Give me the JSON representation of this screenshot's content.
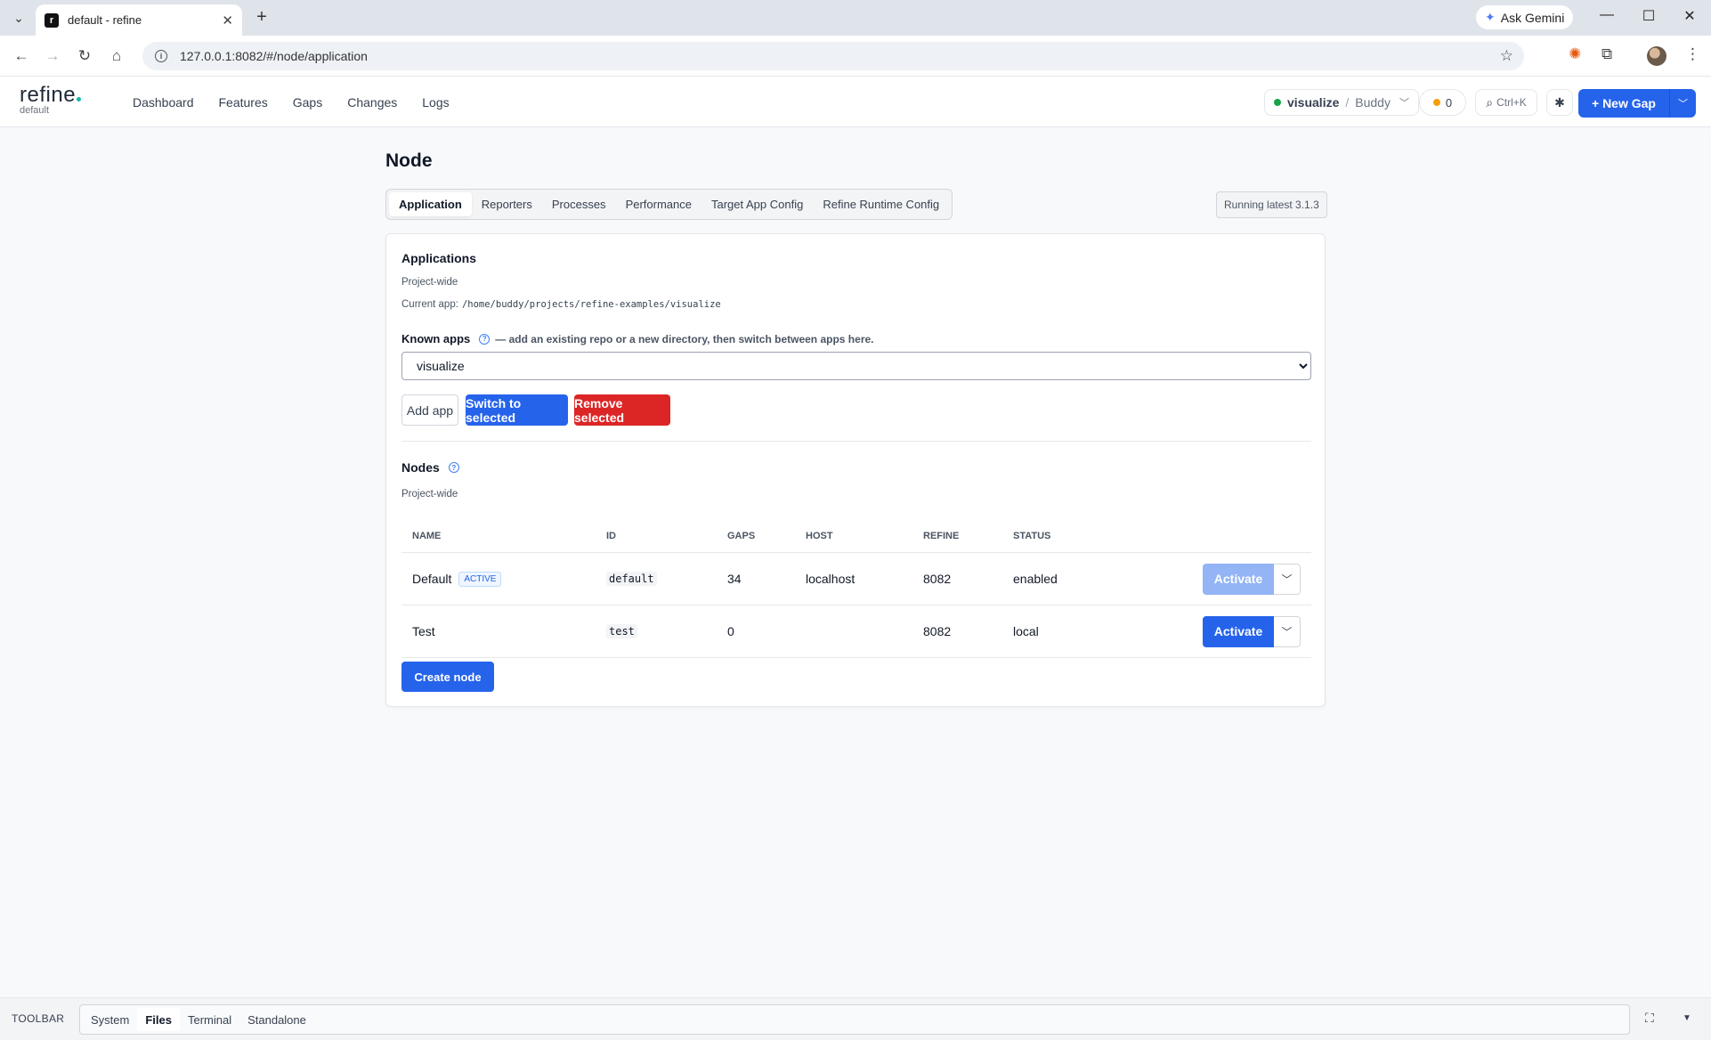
{
  "browser": {
    "tab_title": "default - refine",
    "favicon_letter": "r",
    "url": "127.0.0.1:8082/#/node/application",
    "gemini_label": "Ask Gemini"
  },
  "header": {
    "logo": "refine",
    "logo_sub": "default",
    "nav": [
      "Dashboard",
      "Features",
      "Gaps",
      "Changes",
      "Logs"
    ],
    "context_app": "visualize",
    "context_sep": "/",
    "context_user": "Buddy",
    "count": "0",
    "search_shortcut": "Ctrl+K",
    "new_gap_label": "+ New Gap",
    "accent": "#2563eb"
  },
  "page": {
    "title": "Node",
    "tabs": [
      "Application",
      "Reporters",
      "Processes",
      "Performance",
      "Target App Config",
      "Refine Runtime Config"
    ],
    "version": "Running latest 3.1.3"
  },
  "applications": {
    "title": "Applications",
    "scope": "Project-wide",
    "current_label": "Current app:",
    "current_path": "/home/buddy/projects/refine-examples/visualize",
    "known_label": "Known apps",
    "known_hint": "— add an existing repo or a new directory, then switch between apps here.",
    "selected": "visualize",
    "add_label": "Add app",
    "switch_label": "Switch to selected",
    "remove_label": "Remove selected"
  },
  "nodes": {
    "title": "Nodes",
    "scope": "Project-wide",
    "columns": [
      "NAME",
      "ID",
      "GAPS",
      "HOST",
      "REFINE",
      "STATUS"
    ],
    "rows": [
      {
        "name": "Default",
        "badge": "ACTIVE",
        "id": "default",
        "gaps": "34",
        "host": "localhost",
        "refine": "8082",
        "status": "enabled",
        "action": "Activate"
      },
      {
        "name": "Test",
        "badge": "",
        "id": "test",
        "gaps": "0",
        "host": "",
        "refine": "8082",
        "status": "local",
        "action": "Activate"
      }
    ],
    "create_label": "Create node"
  },
  "toolbar": {
    "label": "TOOLBAR",
    "tabs": [
      "System",
      "Files",
      "Terminal",
      "Standalone"
    ]
  }
}
